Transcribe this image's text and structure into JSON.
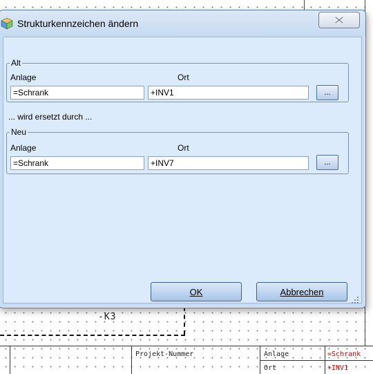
{
  "dialog": {
    "title": "Strukturkennzeichen ändern",
    "close_icon": "close-icon",
    "alt_group": {
      "legend": "Alt",
      "anlage_label": "Anlage",
      "ort_label": "Ort",
      "anlage_value": "=Schrank",
      "ort_value": "+INV1",
      "browse_label": "..."
    },
    "replaced_text": "... wird ersetzt durch ...",
    "neu_group": {
      "legend": "Neu",
      "anlage_label": "Anlage",
      "ort_label": "Ort",
      "anlage_value": "=Schrank",
      "ort_value": "+INV7",
      "browse_label": "..."
    },
    "ok_label": "OK",
    "cancel_label": "Abbrechen"
  },
  "background": {
    "device_tag": "-K3",
    "titleblock": {
      "project_label": "Projekt-Nummer",
      "anlage_label": "Anlage",
      "ort_label": "Ort",
      "anlage_value": "=Schrank",
      "ort_value": "+INV1"
    },
    "colors": {
      "red_text": "#c00000"
    }
  }
}
